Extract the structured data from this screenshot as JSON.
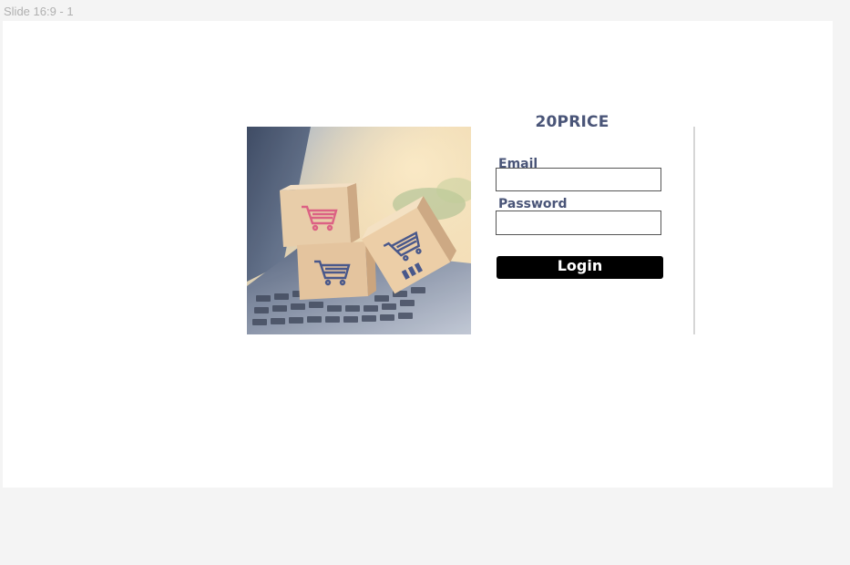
{
  "canvas": {
    "frame_label": "Slide 16:9 - 1"
  },
  "login": {
    "brand": "20PRICE",
    "email_label": "Email",
    "email_value": "",
    "password_label": "Password",
    "password_value": "",
    "login_button": "Login"
  },
  "hero_image": {
    "description_icon": "shopping-cart-icon"
  },
  "colors": {
    "label": "#4a5578",
    "button_bg": "#000000",
    "button_text": "#ffffff",
    "canvas_bg": "#f4f4f4"
  }
}
